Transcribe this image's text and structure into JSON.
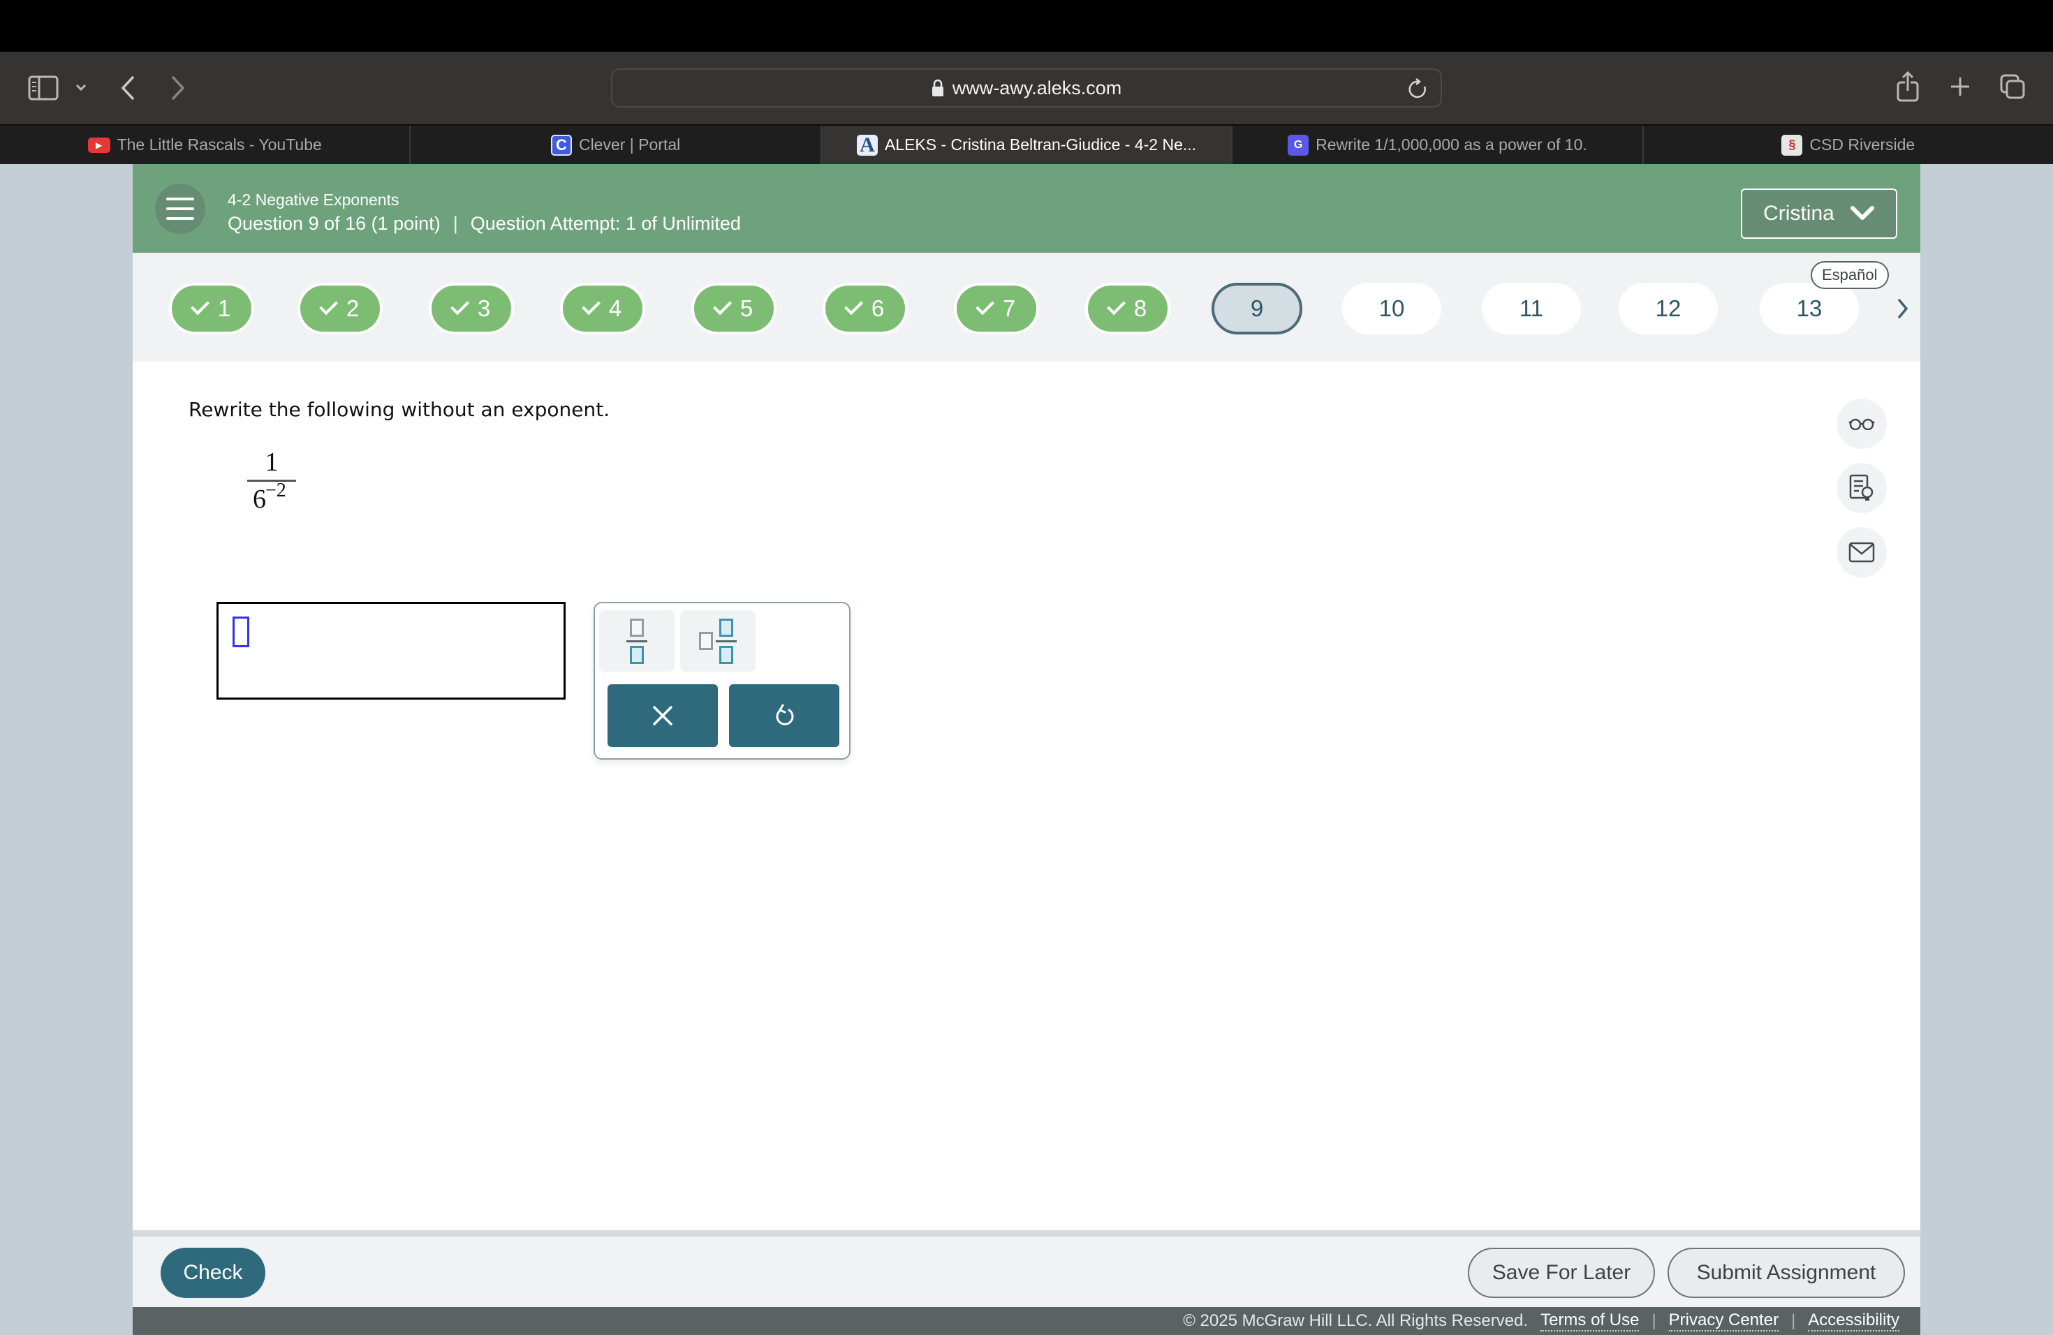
{
  "browser": {
    "url": "www-awy.aleks.com",
    "tabs": [
      {
        "label": "The Little Rascals - YouTube",
        "favicon": "youtube-icon",
        "active": false
      },
      {
        "label": "Clever | Portal",
        "favicon": "clever-icon",
        "favicon_text": "C",
        "active": false
      },
      {
        "label": "ALEKS - Cristina Beltran-Giudice - 4-2 Ne...",
        "favicon": "aleks-icon",
        "favicon_text": "A",
        "active": true
      },
      {
        "label": "Rewrite 1/1,000,000 as a power of 10.",
        "favicon": "gauth-icon",
        "favicon_text": "G",
        "active": false
      },
      {
        "label": "CSD Riverside",
        "favicon": "csd-icon",
        "favicon_text": "§",
        "active": false
      }
    ]
  },
  "header": {
    "topic": "4-2 Negative Exponents",
    "question_info": "Question 9 of 16 (1 point)",
    "separator": "|",
    "attempt_info": "Question Attempt: 1 of Unlimited",
    "user_name": "Cristina"
  },
  "question_nav": {
    "language_button": "Español",
    "items": [
      {
        "label": "1",
        "status": "completed"
      },
      {
        "label": "2",
        "status": "completed"
      },
      {
        "label": "3",
        "status": "completed"
      },
      {
        "label": "4",
        "status": "completed"
      },
      {
        "label": "5",
        "status": "completed"
      },
      {
        "label": "6",
        "status": "completed"
      },
      {
        "label": "7",
        "status": "completed"
      },
      {
        "label": "8",
        "status": "completed"
      },
      {
        "label": "9",
        "status": "current"
      },
      {
        "label": "10",
        "status": "unanswered"
      },
      {
        "label": "11",
        "status": "unanswered"
      },
      {
        "label": "12",
        "status": "unanswered"
      },
      {
        "label": "13",
        "status": "unanswered"
      }
    ]
  },
  "question": {
    "prompt": "Rewrite the following without an exponent.",
    "expression": {
      "numerator": "1",
      "base": "6",
      "exponent": "−2"
    },
    "answer_value": ""
  },
  "palette": {
    "keys": [
      "fraction-template",
      "mixed-number-template"
    ],
    "clear_label": "×",
    "undo_label": "↺"
  },
  "tools": [
    "glasses-icon",
    "worksheet-hint-icon",
    "mail-icon"
  ],
  "actions": {
    "check_label": "Check",
    "save_label": "Save For Later",
    "submit_label": "Submit Assignment"
  },
  "footer": {
    "copyright": "© 2025 McGraw Hill LLC. All Rights Reserved.",
    "links": [
      "Terms of Use",
      "Privacy Center",
      "Accessibility"
    ]
  },
  "colors": {
    "header_green": "#6ea27d",
    "completed_green": "#7cbd73",
    "primary_teal": "#2e6a7c",
    "footer_grey": "#5a6361"
  }
}
